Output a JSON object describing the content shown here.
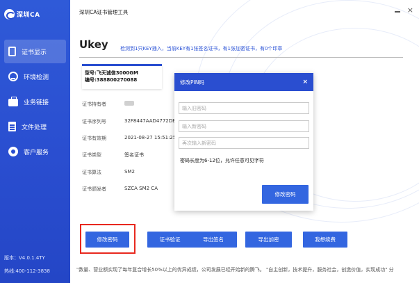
{
  "app": {
    "title": "深圳CA证书管理工具",
    "logo_text": "深圳CA",
    "version": "版本：V4.0.1.4TY",
    "hotline": "热线:400-112-3838"
  },
  "sidebar": {
    "items": [
      {
        "label": "证书显示",
        "icon": "certificate-icon",
        "active": true
      },
      {
        "label": "环境检测",
        "icon": "environment-check-icon",
        "active": false
      },
      {
        "label": "业务链接",
        "icon": "briefcase-icon",
        "active": false
      },
      {
        "label": "文件处理",
        "icon": "file-icon",
        "active": false
      },
      {
        "label": "客户服务",
        "icon": "customer-service-icon",
        "active": false
      }
    ]
  },
  "main": {
    "heading": "Ukey",
    "detect_message": "检测到1只KEY插入，当前KEY有1张签名证书，有1张加密证书，有0个印章",
    "card": {
      "model": "型号:飞天诚信3000GM",
      "serial": "编号:388800270088"
    },
    "info_rows": [
      {
        "label": "证书持有者",
        "value": ""
      },
      {
        "label": "证书序列号",
        "value": "32F8447AAD4772DB"
      },
      {
        "label": "证书有效期",
        "value": "2021-08-27 15:51:25-"
      },
      {
        "label": "证书类型",
        "value": "签名证书"
      },
      {
        "label": "证书算法",
        "value": "SM2"
      },
      {
        "label": "证书颁发者",
        "value": "SZCA SM2 CA"
      }
    ],
    "buttons": {
      "change_pin": "修改密码",
      "cert_verify": "证书验证",
      "export_sign": "导出签名",
      "export_enc": "导出加密",
      "renew": "我想续费"
    },
    "slogan": "\"数量、营业额实现了每年复合增长50%以上的优异成绩，公司发展已经开始新的腾飞。  \"自主创新，技术提升，服务社会，创造价值，实现成功\"  分"
  },
  "modal": {
    "title": "修改PIN码",
    "close": "×",
    "old_pin_placeholder": "输入旧密码",
    "new_pin_placeholder": "输入新密码",
    "confirm_pin_placeholder": "再次输入新密码",
    "hint": "密码长度为6-12位，允许任意可见字符",
    "submit": "修改密码"
  }
}
